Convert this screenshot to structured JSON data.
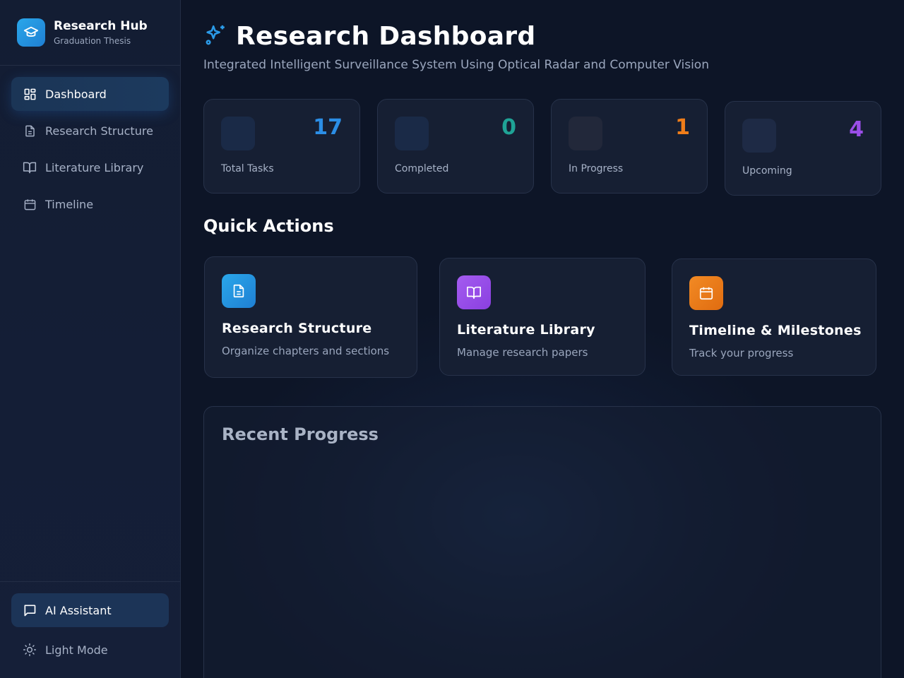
{
  "brand": {
    "title": "Research Hub",
    "subtitle": "Graduation Thesis",
    "icon": "graduation-cap-icon"
  },
  "sidebar": {
    "items": [
      {
        "label": "Dashboard",
        "icon": "grid-icon",
        "active": true
      },
      {
        "label": "Research Structure",
        "icon": "document-icon",
        "active": false
      },
      {
        "label": "Literature Library",
        "icon": "book-icon",
        "active": false
      },
      {
        "label": "Timeline",
        "icon": "calendar-icon",
        "active": false
      }
    ],
    "ai_assistant": {
      "label": "AI Assistant",
      "icon": "chat-icon"
    },
    "theme_toggle": {
      "label": "Light Mode",
      "icon": "sun-icon"
    }
  },
  "header": {
    "title": "Research Dashboard",
    "icon": "sparkles-icon",
    "subtitle": "Integrated Intelligent Surveillance System Using Optical Radar and Computer Vision"
  },
  "stats": [
    {
      "value": "17",
      "label": "Total Tasks",
      "color": "#2b8ee6"
    },
    {
      "value": "0",
      "label": "Completed",
      "color": "#1fa396"
    },
    {
      "value": "1",
      "label": "In Progress",
      "color": "#ef7d1a"
    },
    {
      "value": "4",
      "label": "Upcoming",
      "color": "#9a4ee8"
    }
  ],
  "quick_actions": {
    "title": "Quick Actions",
    "cards": [
      {
        "title": "Research Structure",
        "description": "Organize chapters and sections",
        "icon": "document-icon",
        "color": "#2b8ee6"
      },
      {
        "title": "Literature Library",
        "description": "Manage research papers",
        "icon": "book-icon",
        "color": "#9a4ee8"
      },
      {
        "title": "Timeline & Milestones",
        "description": "Track your progress",
        "icon": "calendar-icon",
        "color": "#ef7d1a"
      }
    ]
  },
  "recent_progress": {
    "title": "Recent Progress"
  }
}
